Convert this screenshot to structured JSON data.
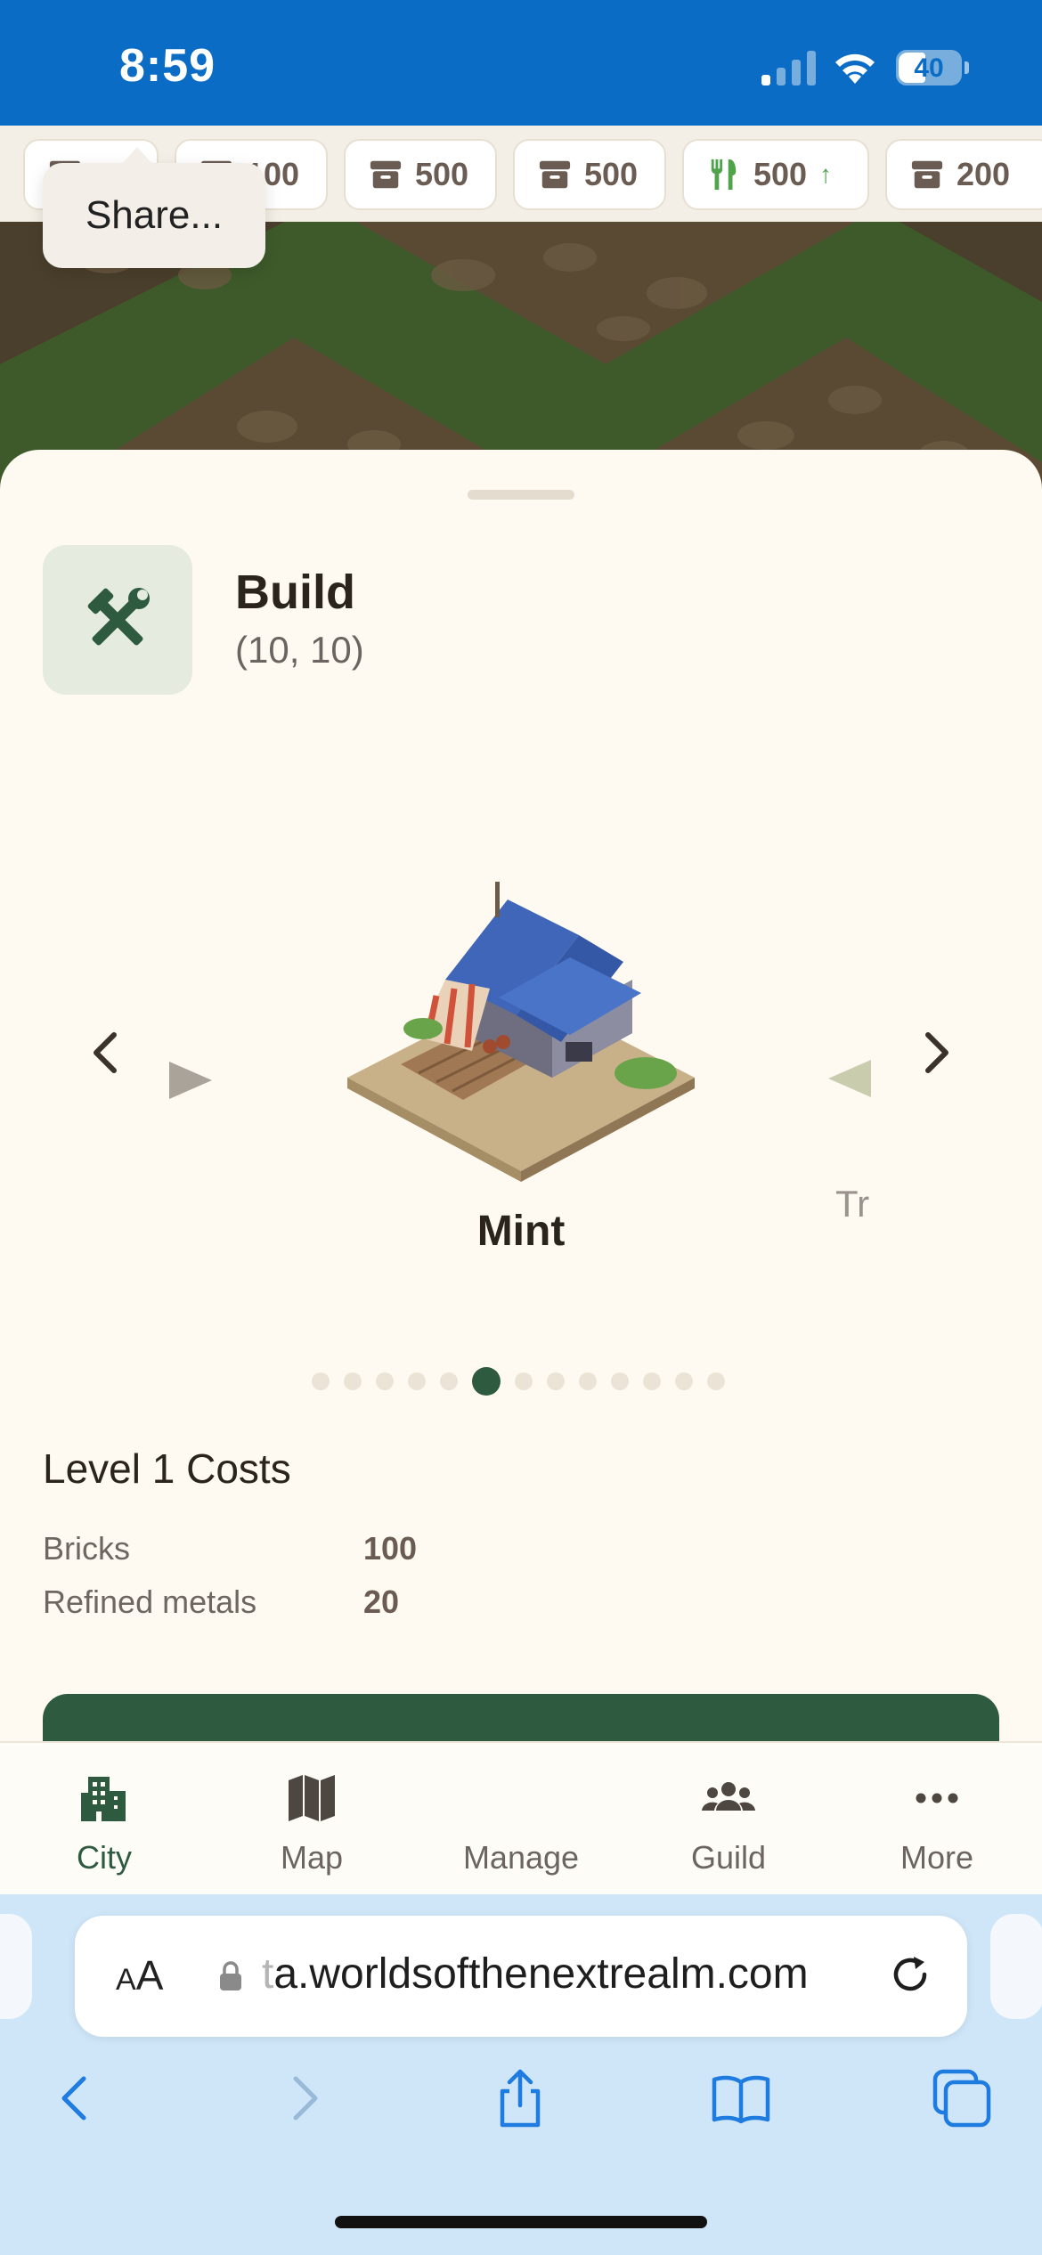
{
  "status_bar": {
    "time": "8:59",
    "battery_level": "40"
  },
  "resources": [
    {
      "icon": "crate-icon",
      "value": ""
    },
    {
      "icon": "crate-icon",
      "value": "100"
    },
    {
      "icon": "crate-icon",
      "value": "500"
    },
    {
      "icon": "crate-icon",
      "value": "500"
    },
    {
      "icon": "food-icon",
      "value": "500",
      "trend": "↑"
    },
    {
      "icon": "crate-icon",
      "value": "200"
    }
  ],
  "share_popup": {
    "label": "Share..."
  },
  "panel": {
    "title": "Build",
    "coords": "(10, 10)",
    "icon": "hammer-wrench-icon"
  },
  "carousel": {
    "current_name": "Mint",
    "next_name_peek": "Tra",
    "dot_count": 13,
    "active_index": 5
  },
  "costs": {
    "title": "Level 1 Costs",
    "rows": [
      {
        "label": "Bricks",
        "value": "100"
      },
      {
        "label": "Refined metals",
        "value": "20"
      }
    ]
  },
  "tabs": [
    {
      "label": "City",
      "icon": "city-icon",
      "active": true
    },
    {
      "label": "Map",
      "icon": "map-icon",
      "active": false
    },
    {
      "label": "Manage",
      "icon": "",
      "active": false
    },
    {
      "label": "Guild",
      "icon": "group-icon",
      "active": false
    },
    {
      "label": "More",
      "icon": "more-icon",
      "active": false
    }
  ],
  "browser": {
    "text_size_label": "AA",
    "url_faded": "t",
    "url": "a.worldsofthenextrealm.com"
  },
  "colors": {
    "status_bar": "#0a6cc4",
    "accent_green": "#2e5b3f",
    "sheet_bg": "#fefaf1",
    "food_green": "#4fa34a",
    "browser_bg": "#cfe6f8"
  }
}
